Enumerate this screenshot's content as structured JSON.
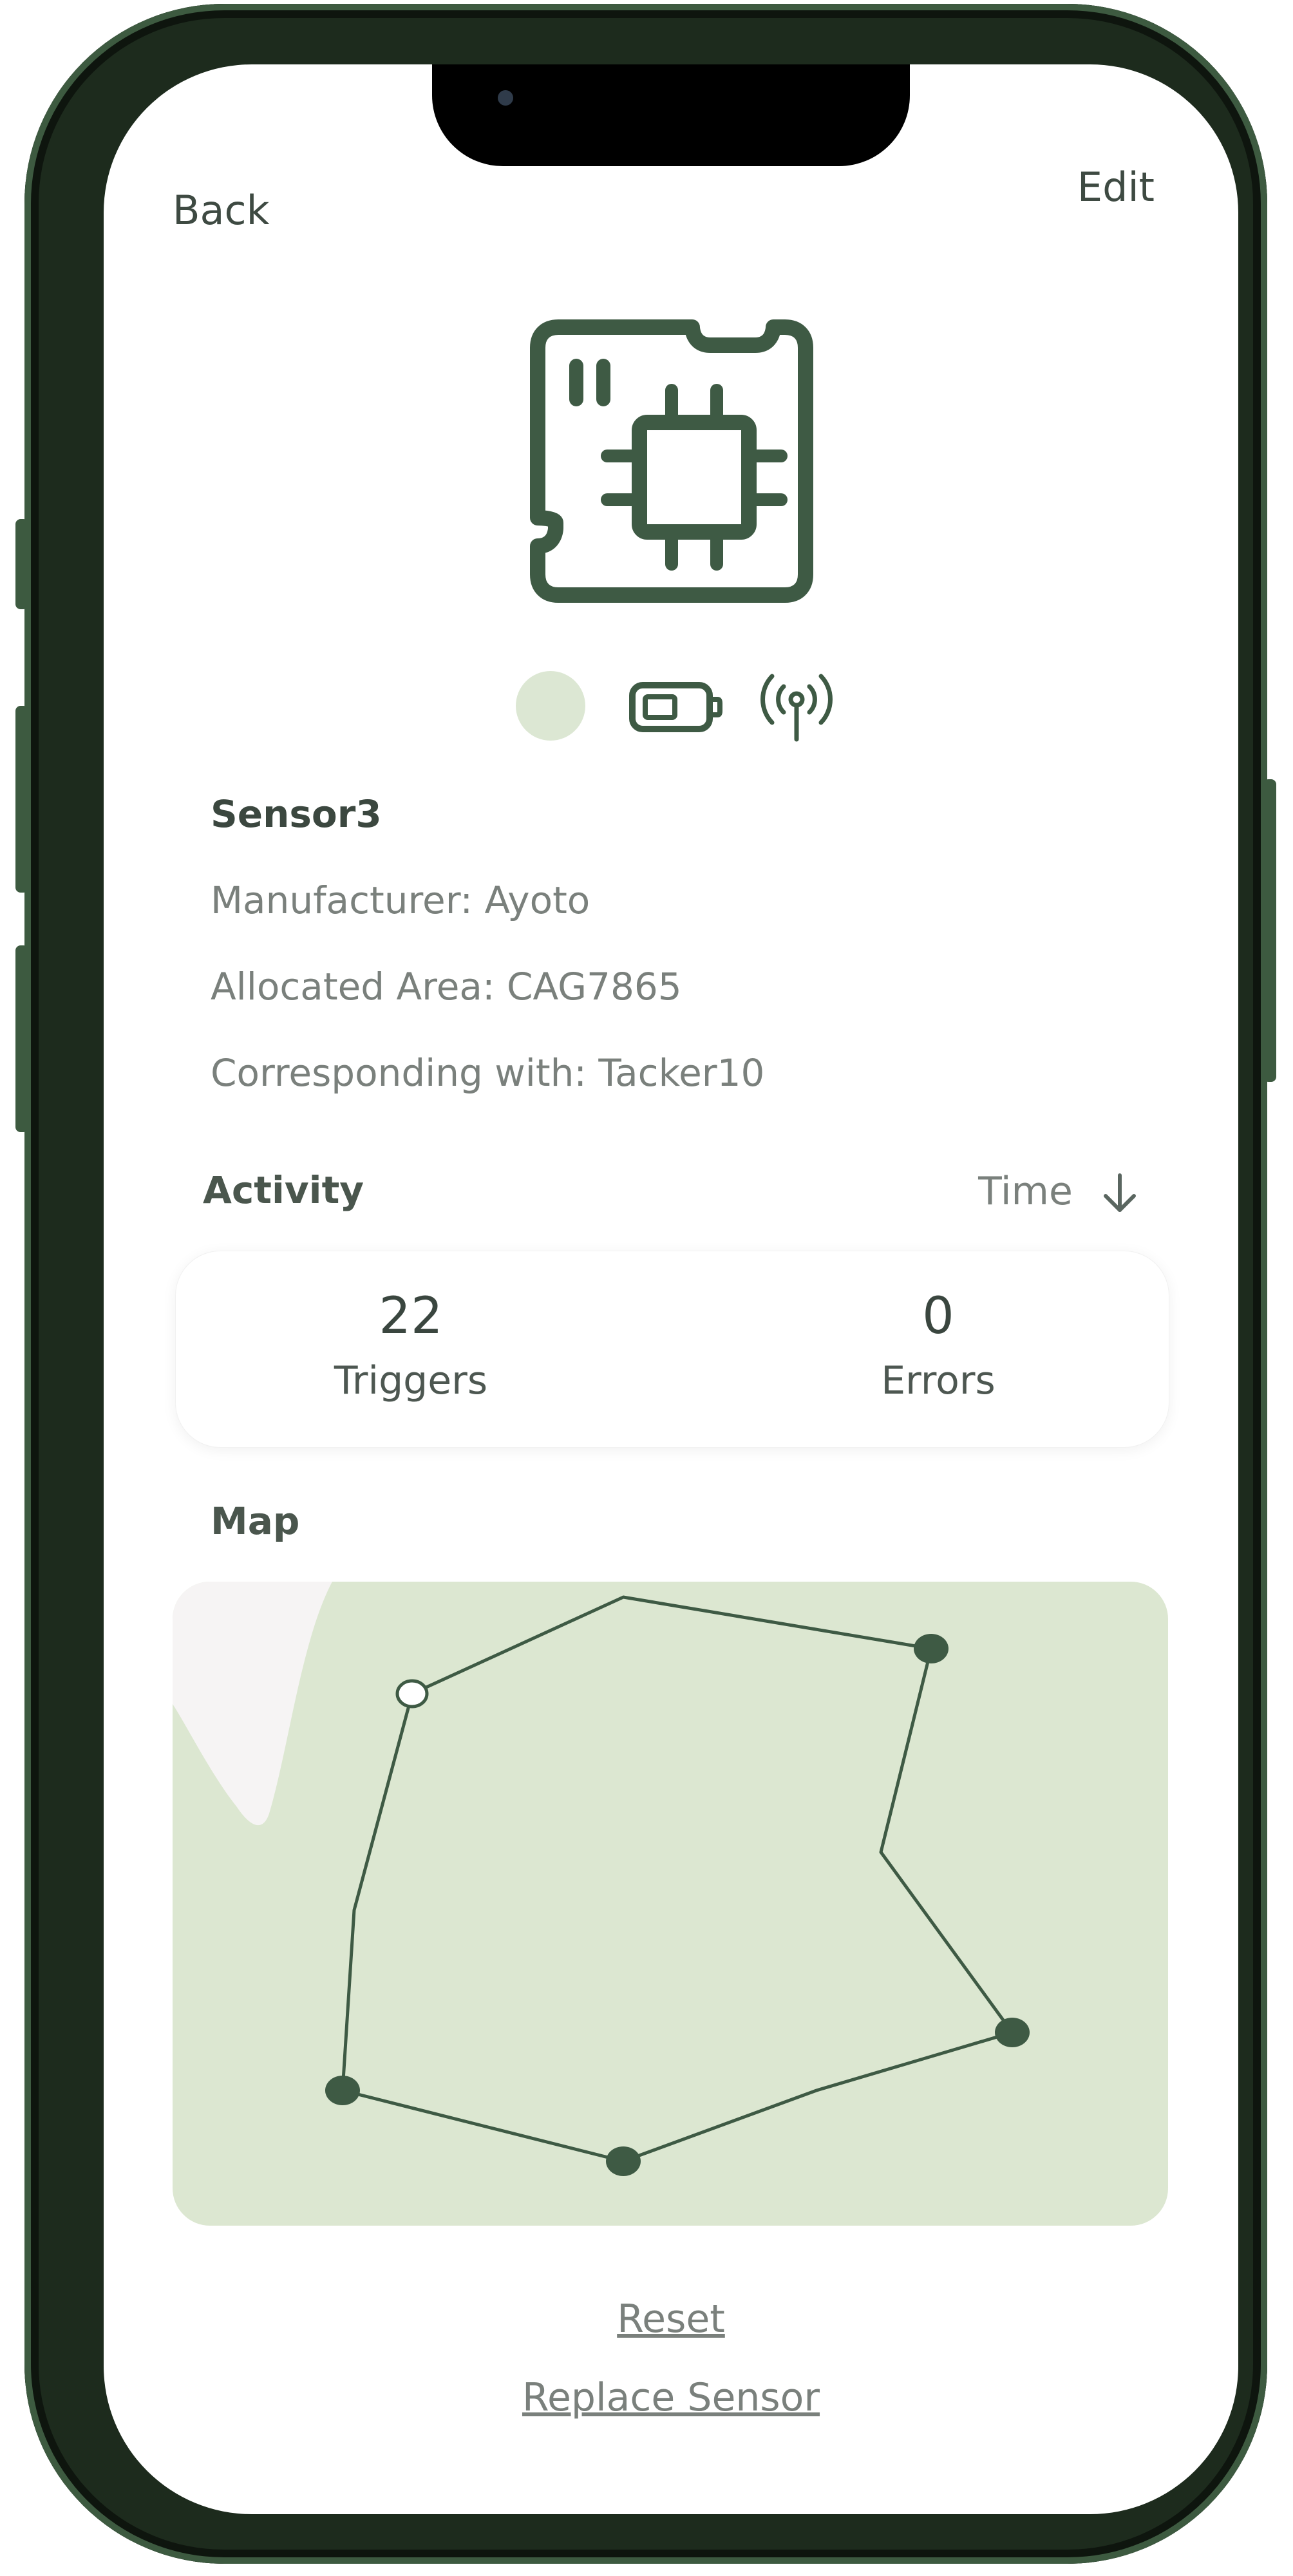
{
  "nav": {
    "back_label": "Back",
    "edit_label": "Edit"
  },
  "device": {
    "icon": "circuit-board-icon",
    "status_indicators": {
      "status_dot_color": "#dce7d3",
      "battery_icon": "battery-icon",
      "signal_icon": "signal-antenna-icon"
    },
    "name": "Sensor3",
    "manufacturer": "Manufacturer: Ayoto",
    "allocated_area": "Allocated Area: CAG7865",
    "corresponding_with": "Corresponding with: Tacker10"
  },
  "activity": {
    "title": "Activity",
    "sort_label": "Time",
    "sort_icon": "arrow-down-icon",
    "stats": [
      {
        "value": "22",
        "label": "Triggers"
      },
      {
        "value": "0",
        "label": "Errors"
      }
    ]
  },
  "map": {
    "title": "Map",
    "colors": {
      "land": "#dce7d1",
      "water": "#f6f4f4",
      "route": "#3e5a44"
    }
  },
  "actions": {
    "reset_label": "Reset",
    "replace_label": "Replace Sensor"
  },
  "colors": {
    "primary": "#3e5a44",
    "text": "#3b473f",
    "muted": "#7a807c"
  }
}
